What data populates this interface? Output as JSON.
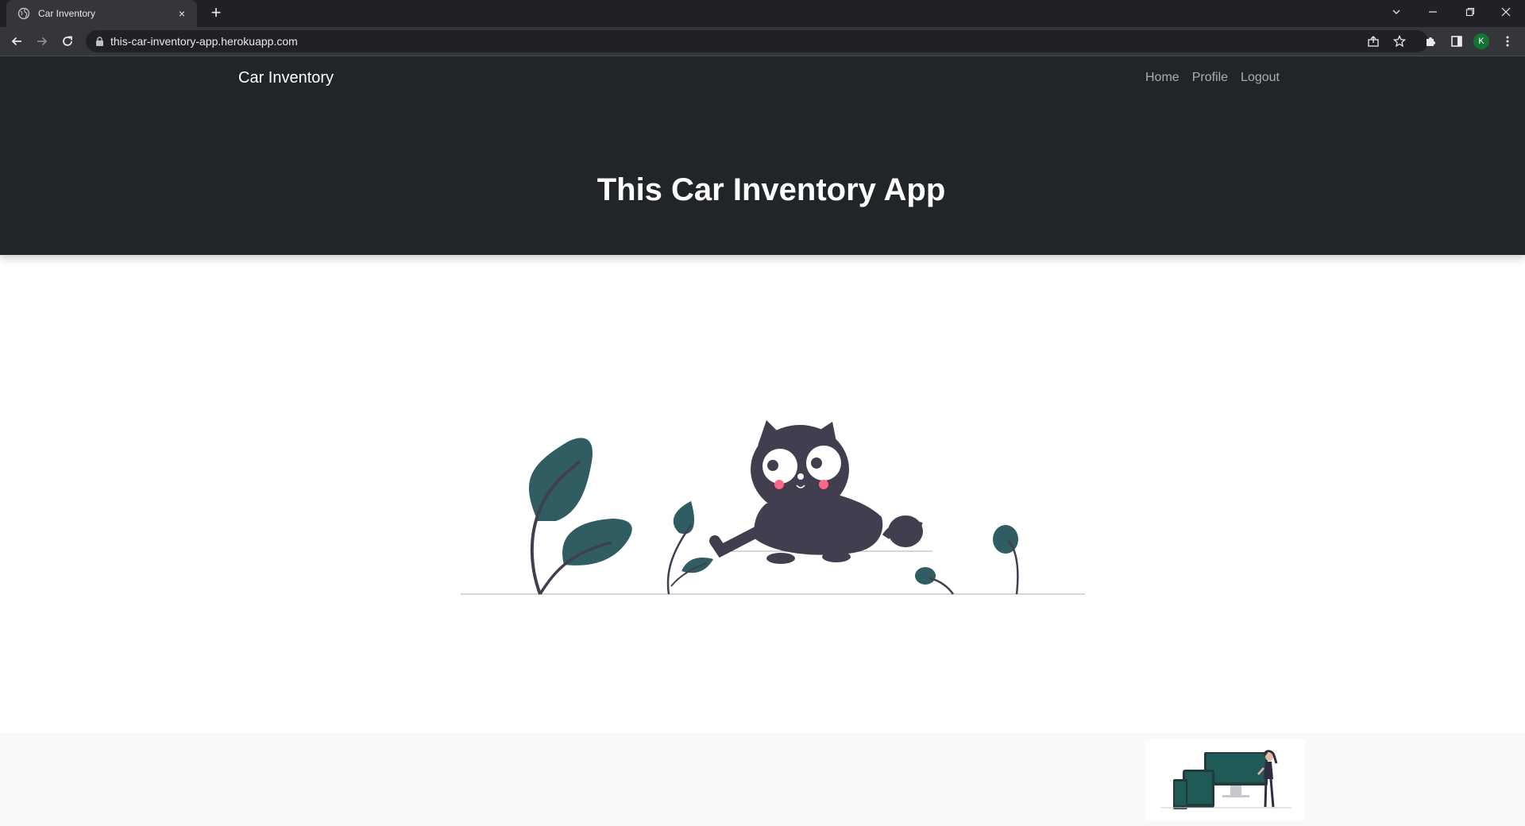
{
  "browser": {
    "tab_title": "Car Inventory",
    "tab_close": "×",
    "new_tab": "+",
    "url": "this-car-inventory-app.herokuapp.com",
    "profile_initial": "K"
  },
  "navbar": {
    "brand": "Car Inventory",
    "links": [
      "Home",
      "Profile",
      "Logout"
    ]
  },
  "hero": {
    "title": "This Car Inventory App"
  },
  "colors": {
    "hero_bg": "#212529",
    "leaf": "#2f5d62",
    "cat": "#433d50",
    "cheek": "#ff6584",
    "footer_bg": "#f8f9fa"
  },
  "icons": [
    "globe-icon",
    "close-icon",
    "plus-icon",
    "chevron-down-icon",
    "minimize-icon",
    "restore-icon",
    "window-close-icon",
    "back-icon",
    "forward-icon",
    "reload-icon",
    "lock-icon",
    "share-icon",
    "star-icon",
    "extensions-icon",
    "side-panel-icon",
    "kebab-menu-icon"
  ]
}
